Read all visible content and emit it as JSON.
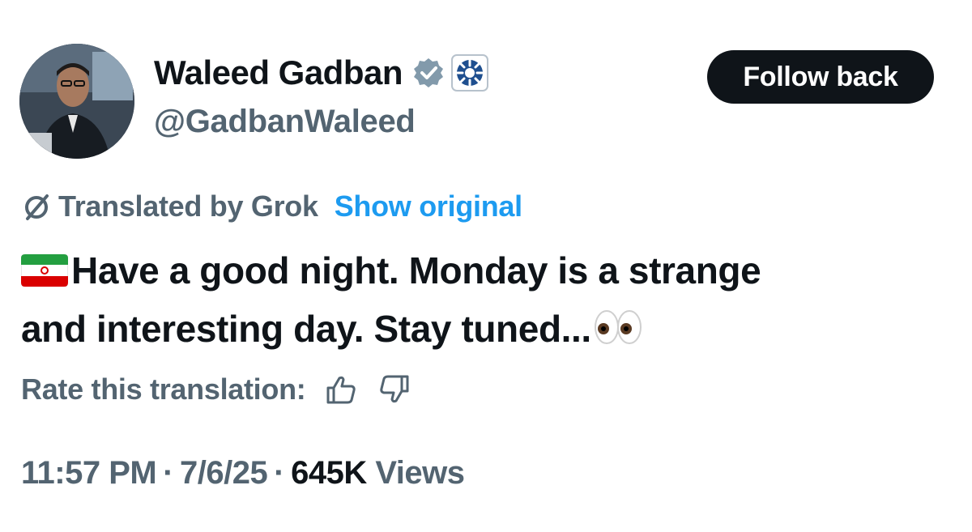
{
  "author": {
    "display_name": "Waleed Gadban",
    "handle": "@GadbanWaleed",
    "verified_icon": "verified-badge-icon",
    "affiliation_icon": "affiliation-emblem-icon",
    "avatar_icon": "profile-photo-avatar"
  },
  "follow_button": {
    "label": "Follow back"
  },
  "translation": {
    "label": "Translated by Grok",
    "show_original": "Show original",
    "icon": "grok-icon"
  },
  "tweet": {
    "flag_icon": "iran-flag-emoji",
    "line1": "Have a good night. Monday is a strange",
    "line2": "and interesting day. Stay tuned...",
    "trailing_icon": "eyes-emoji"
  },
  "rating": {
    "label": "Rate this translation:",
    "thumbs_up_icon": "thumbs-up-icon",
    "thumbs_down_icon": "thumbs-down-icon"
  },
  "meta": {
    "time": "11:57 PM",
    "date": "7/6/25",
    "separator": "·",
    "views_count": "645K",
    "views_label": "Views"
  },
  "colors": {
    "text_primary": "#0f1419",
    "text_secondary": "#536471",
    "link_blue": "#1d9bf0",
    "button_bg": "#0f1419",
    "button_text": "#ffffff",
    "background": "#ffffff"
  }
}
